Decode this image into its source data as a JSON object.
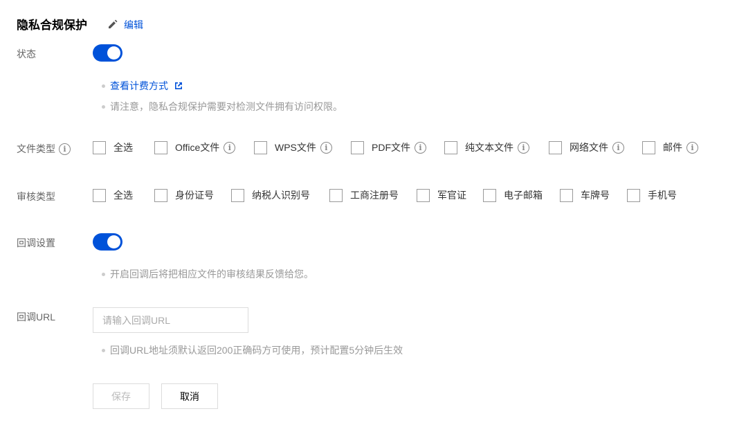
{
  "header": {
    "title": "隐私合规保护",
    "edit_label": "编辑"
  },
  "status": {
    "label": "状态",
    "enabled": true,
    "pricing_link": "查看计费方式",
    "notice": "请注意，隐私合规保护需要对检测文件拥有访问权限。"
  },
  "file_types": {
    "label": "文件类型",
    "options": [
      {
        "label": "全选",
        "checked": false,
        "info": false
      },
      {
        "label": "Office文件",
        "checked": false,
        "info": true
      },
      {
        "label": "WPS文件",
        "checked": false,
        "info": true
      },
      {
        "label": "PDF文件",
        "checked": false,
        "info": true
      },
      {
        "label": "纯文本文件",
        "checked": false,
        "info": true
      },
      {
        "label": "网络文件",
        "checked": false,
        "info": true
      },
      {
        "label": "邮件",
        "checked": false,
        "info": true
      }
    ]
  },
  "audit_types": {
    "label": "审核类型",
    "options": [
      {
        "label": "全选",
        "checked": false
      },
      {
        "label": "身份证号",
        "checked": false
      },
      {
        "label": "纳税人识别号",
        "checked": false
      },
      {
        "label": "工商注册号",
        "checked": false
      },
      {
        "label": "军官证",
        "checked": false
      },
      {
        "label": "电子邮箱",
        "checked": false
      },
      {
        "label": "车牌号",
        "checked": false
      },
      {
        "label": "手机号",
        "checked": false
      }
    ]
  },
  "callback": {
    "label": "回调设置",
    "enabled": true,
    "notice": "开启回调后将把相应文件的审核结果反馈给您。"
  },
  "callback_url": {
    "label": "回调URL",
    "value": "",
    "placeholder": "请输入回调URL",
    "notice": "回调URL地址须默认返回200正确码方可使用，预计配置5分钟后生效"
  },
  "actions": {
    "save_label": "保存",
    "cancel_label": "取消"
  },
  "colors": {
    "accent": "#0052d9",
    "label": "#666666",
    "hint": "#999999"
  },
  "icons": {
    "edit": "pencil-icon",
    "external": "external-link-icon",
    "info": "info-circle-icon"
  }
}
